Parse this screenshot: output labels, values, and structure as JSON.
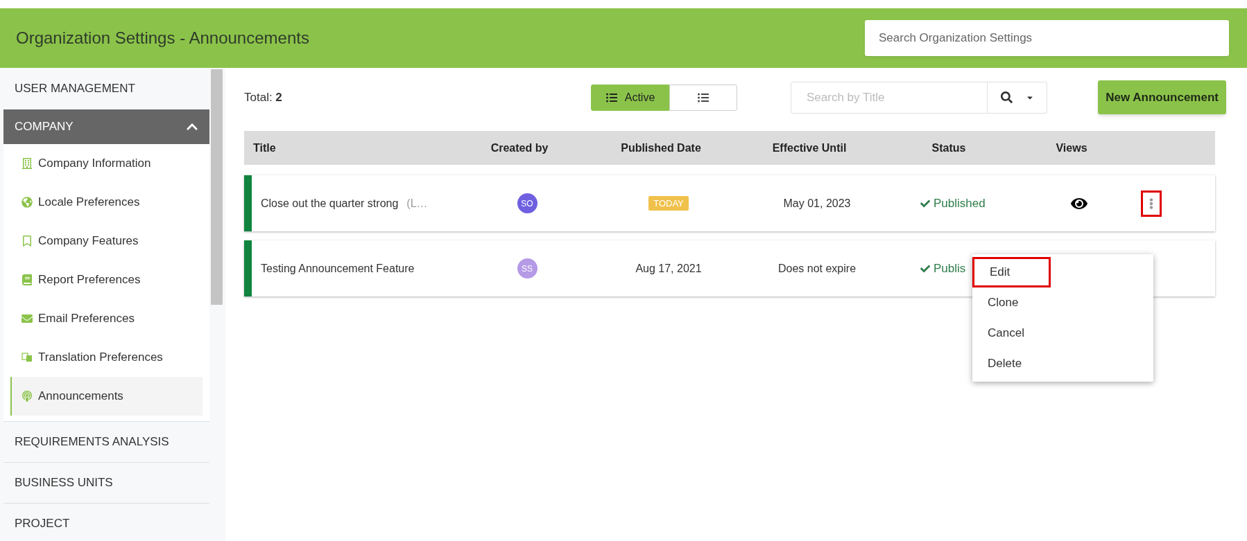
{
  "header": {
    "title": "Organization Settings - Announcements",
    "search": {
      "placeholder": "Search Organization Settings"
    }
  },
  "sidebar": {
    "items": [
      {
        "label": "USER MANAGEMENT",
        "expanded": false
      },
      {
        "label": "COMPANY",
        "expanded": true,
        "children": [
          {
            "label": "Company Information",
            "kind": "building",
            "selected": false
          },
          {
            "label": "Locale Preferences",
            "kind": "globe",
            "selected": false
          },
          {
            "label": "Company Features",
            "kind": "bookmark",
            "selected": false
          },
          {
            "label": "Report Preferences",
            "kind": "book",
            "selected": false
          },
          {
            "label": "Email Preferences",
            "kind": "envelope",
            "selected": false
          },
          {
            "label": "Translation Preferences",
            "kind": "language",
            "selected": false
          },
          {
            "label": "Announcements",
            "kind": "podcast",
            "selected": true
          }
        ]
      },
      {
        "label": "REQUIREMENTS ANALYSIS",
        "expanded": false
      },
      {
        "label": "BUSINESS UNITS",
        "expanded": false
      },
      {
        "label": "PROJECT",
        "expanded": false
      }
    ]
  },
  "toolbar": {
    "total": "Total: **2**",
    "views": [
      {
        "label": "Active",
        "selected": true
      },
      {
        "selected": false
      }
    ],
    "search": {
      "placeholder": "Search by Title"
    },
    "new_button": "New Announcement"
  },
  "table": {
    "columns": [
      "Title",
      "Created by",
      "Published Date",
      "Effective Until",
      "Status",
      "Views"
    ],
    "rows": [
      {
        "title": "Close out the quarter strong",
        "title_suffix": "(L…",
        "avatar": "SO",
        "color": "#6f60e0",
        "published": {
          "kind": "badge",
          "text": "TODAY"
        },
        "effective": "May 01, 2023",
        "status": "Published",
        "views": true,
        "highlighted": true
      },
      {
        "title": "Testing Announcement Feature",
        "avatar": "SS",
        "color": "#b59ae6",
        "published": {
          "kind": "text",
          "text": "Aug 17, 2021"
        },
        "effective": "Does not expire",
        "status": "Publis",
        "highlighted": false
      }
    ]
  },
  "menu": {
    "items": [
      {
        "label": "Edit",
        "highlighted": true
      },
      {
        "label": "Clone",
        "highlighted": false
      },
      {
        "label": "Cancel",
        "highlighted": false
      },
      {
        "label": "Delete",
        "highlighted": false
      }
    ]
  }
}
